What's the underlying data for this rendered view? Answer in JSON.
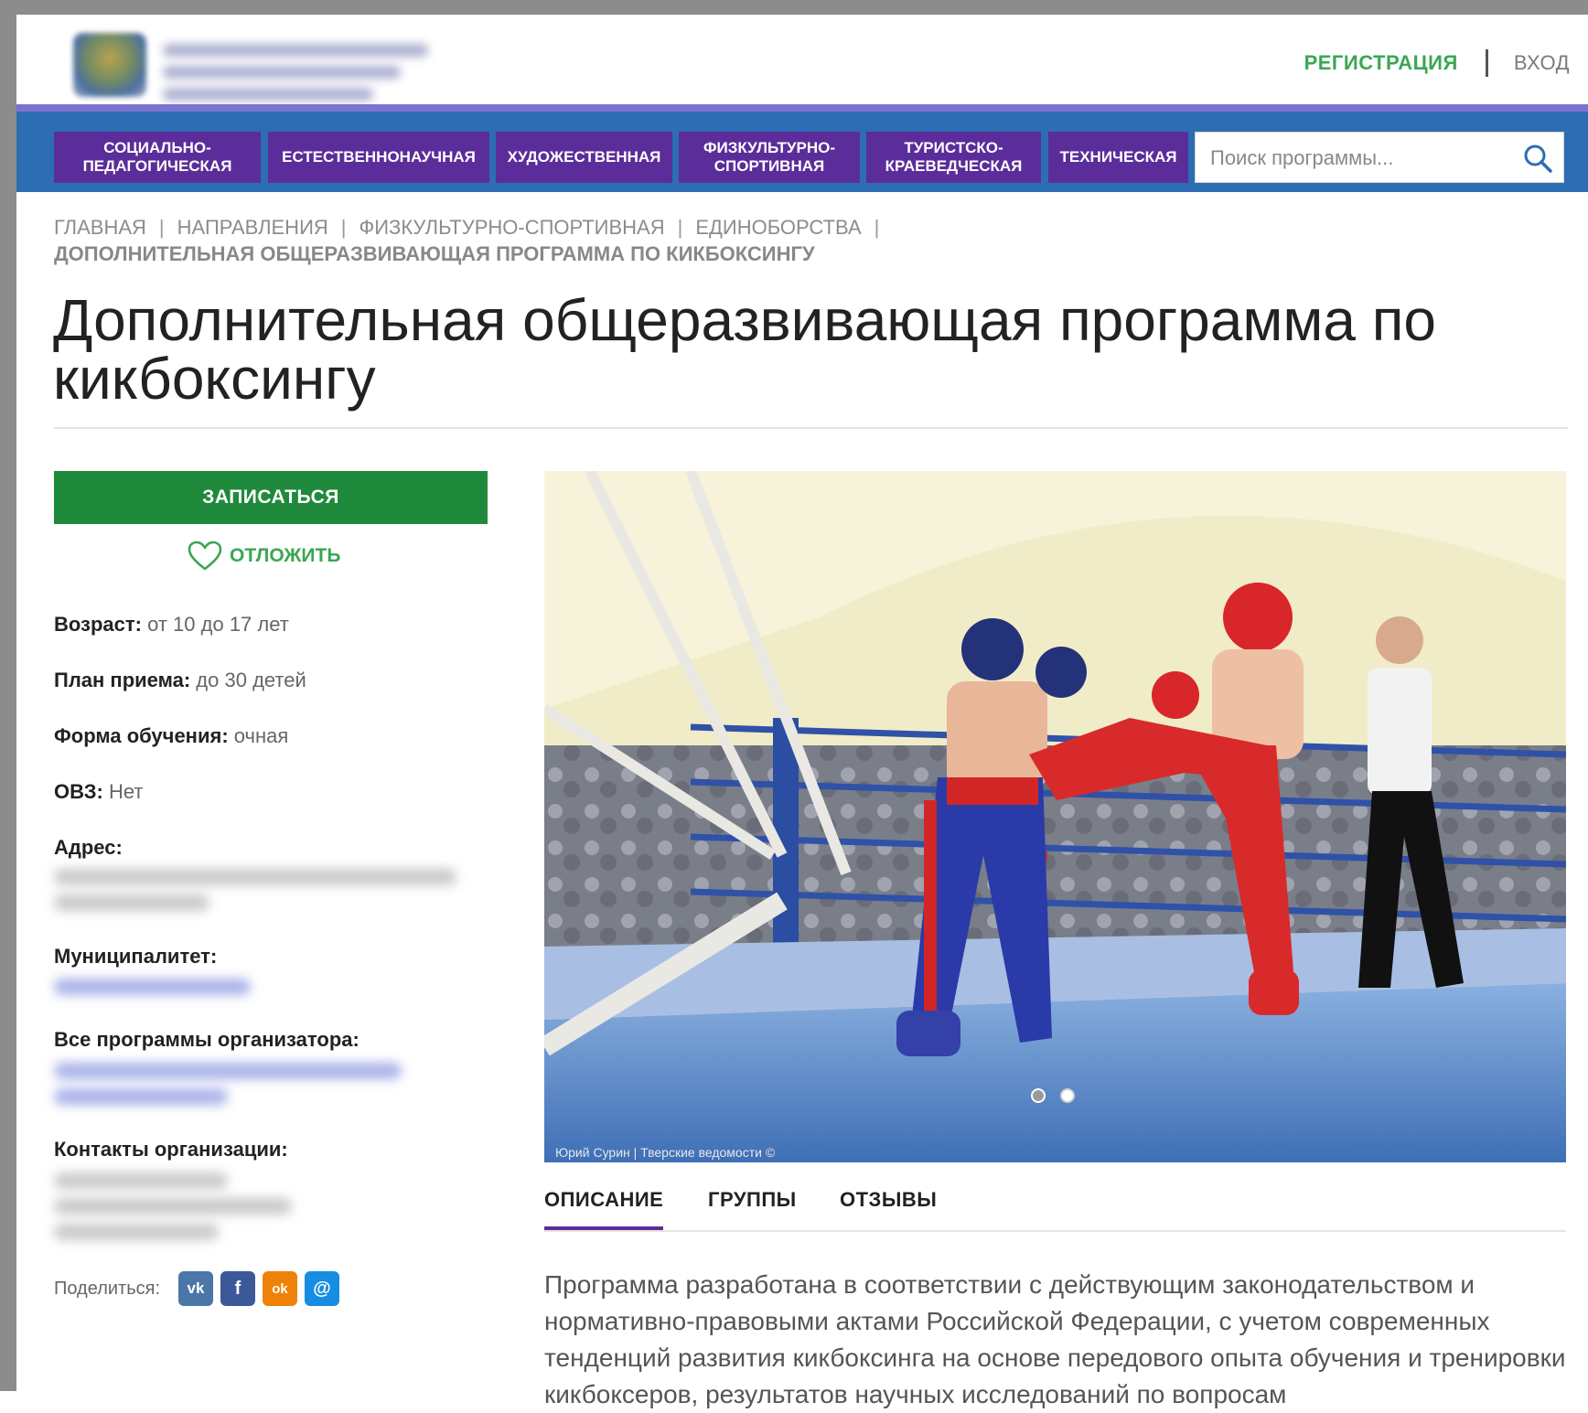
{
  "header": {
    "register_label": "РЕГИСТРАЦИЯ",
    "login_label": "ВХОД"
  },
  "nav": {
    "items": [
      {
        "label": "СОЦИАЛЬНО-ПЕДАГОГИЧЕСКАЯ"
      },
      {
        "label": "ЕСТЕСТВЕННОНАУЧНАЯ"
      },
      {
        "label": "ХУДОЖЕСТВЕННАЯ"
      },
      {
        "label": "ФИЗКУЛЬТУРНО-СПОРТИВНАЯ"
      },
      {
        "label": "ТУРИСТСКО-КРАЕВЕДЧЕСКАЯ"
      },
      {
        "label": "ТЕХНИЧЕСКАЯ"
      }
    ],
    "search_placeholder": "Поиск программы..."
  },
  "breadcrumb": {
    "items": [
      "ГЛАВНАЯ",
      "НАПРАВЛЕНИЯ",
      "ФИЗКУЛЬТУРНО-СПОРТИВНАЯ",
      "ЕДИНОБОРСТВА"
    ],
    "current": "ДОПОЛНИТЕЛЬНАЯ ОБЩЕРАЗВИВАЮЩАЯ ПРОГРАММА ПО КИКБОКСИНГУ"
  },
  "page": {
    "title": "Дополнительная общеразвивающая программа по кикбоксингу"
  },
  "actions": {
    "enroll_label": "ЗАПИСАТЬСЯ",
    "postpone_label": "ОТЛОЖИТЬ"
  },
  "details": {
    "age_label": "Возраст:",
    "age_value": "от 10 до 17 лет",
    "plan_label": "План приема:",
    "plan_value": "до 30 детей",
    "form_label": "Форма обучения:",
    "form_value": "очная",
    "ovz_label": "ОВЗ:",
    "ovz_value": "Нет",
    "address_label": "Адрес:",
    "municipality_label": "Муниципалитет:",
    "all_programs_label": "Все программы организатора:",
    "contacts_label": "Контакты организации:"
  },
  "share": {
    "label": "Поделиться:",
    "buttons": [
      {
        "icon": "vk-icon",
        "glyph": "vk",
        "color": "#4a76a8"
      },
      {
        "icon": "facebook-icon",
        "glyph": "f",
        "color": "#3b5998"
      },
      {
        "icon": "odnoklassniki-icon",
        "glyph": "ok",
        "color": "#ee8208"
      },
      {
        "icon": "moimir-icon",
        "glyph": "@",
        "color": "#168de2"
      }
    ]
  },
  "photo": {
    "caption": "Юрий Сурин | Тверские ведомости ©",
    "slides_total": 2,
    "active_slide": 1
  },
  "tabs": [
    {
      "label": "ОПИСАНИЕ",
      "active": true
    },
    {
      "label": "ГРУППЫ",
      "active": false
    },
    {
      "label": "ОТЗЫВЫ",
      "active": false
    }
  ],
  "description": "Программа разработана в соответствии с действующим законодательством и нормативно-правовыми актами Российской Федерации, с учетом современных тенденций развития кикбоксинга на основе передового опыта обучения и тренировки кикбоксеров, результатов научных исследований по вопросам",
  "colors": {
    "nav_bg": "#2d6db3",
    "nav_item_bg": "#5b2d9a",
    "accent_green": "#3aa753",
    "enroll_green": "#1f8a3b"
  }
}
